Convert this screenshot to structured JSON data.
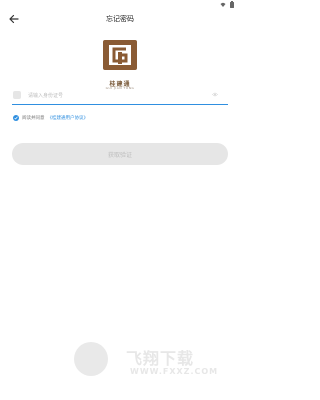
{
  "header": {
    "title": "忘记密码"
  },
  "logo": {
    "text": "桂建通",
    "subtext": "GUI JIAN TONG"
  },
  "id_field": {
    "placeholder": "请输入身份证号",
    "value": ""
  },
  "agreement": {
    "text": "阅读并同意",
    "link": "《桂建通用户协议》"
  },
  "submit": {
    "label": "获取验证"
  },
  "watermark": {
    "main": "飞翔下载",
    "url": "WWW.FXXZ.COM"
  },
  "colors": {
    "accent": "#2f8fe0",
    "brand": "#8a5b34",
    "disabled_bg": "#e6e6e6",
    "disabled_text": "#bdbdbd"
  },
  "icons": {
    "back": "arrow-left-icon",
    "eye": "eye-icon",
    "check": "check-circle-icon",
    "wifi": "wifi-icon",
    "battery": "battery-icon"
  }
}
